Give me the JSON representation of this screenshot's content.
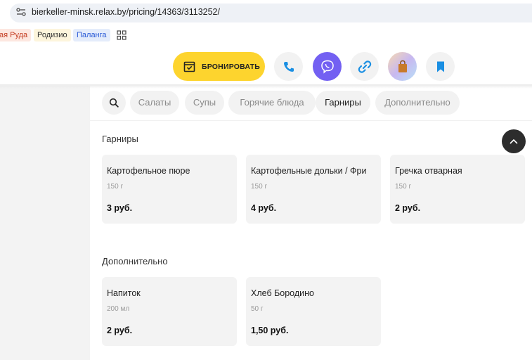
{
  "browser": {
    "url": "bierkeller-minsk.relax.by/pricing/14363/3113252/",
    "bookmarks": [
      "ая Руда",
      "Родизио",
      "Паланга"
    ]
  },
  "actions": {
    "book_label": "БРОНИРОВАТЬ",
    "icons": [
      "calendar-icon",
      "phone-icon",
      "viber-icon",
      "link-icon",
      "bag-icon",
      "bookmark-icon"
    ]
  },
  "categories": {
    "items": [
      "Салаты",
      "Супы",
      "Горячие блюда",
      "Гарниры",
      "Дополнительно"
    ],
    "active": "Гарниры"
  },
  "sections": [
    {
      "title": "Гарниры",
      "items": [
        {
          "name": "Картофельное пюре",
          "weight": "150 г",
          "price": "3 руб."
        },
        {
          "name": "Картофельные дольки / Фри",
          "weight": "150 г",
          "price": "4 руб."
        },
        {
          "name": "Гречка отварная",
          "weight": "150 г",
          "price": "2 руб."
        }
      ]
    },
    {
      "title": "Дополнительно",
      "items": [
        {
          "name": "Напиток",
          "weight": "200 мл",
          "price": "2 руб."
        },
        {
          "name": "Хлеб Бородино",
          "weight": "50 г",
          "price": "1,50 руб."
        }
      ]
    }
  ],
  "colors": {
    "accent_yellow": "#fdd42e",
    "viber_purple": "#7360f2",
    "link_blue": "#1a73e8"
  }
}
